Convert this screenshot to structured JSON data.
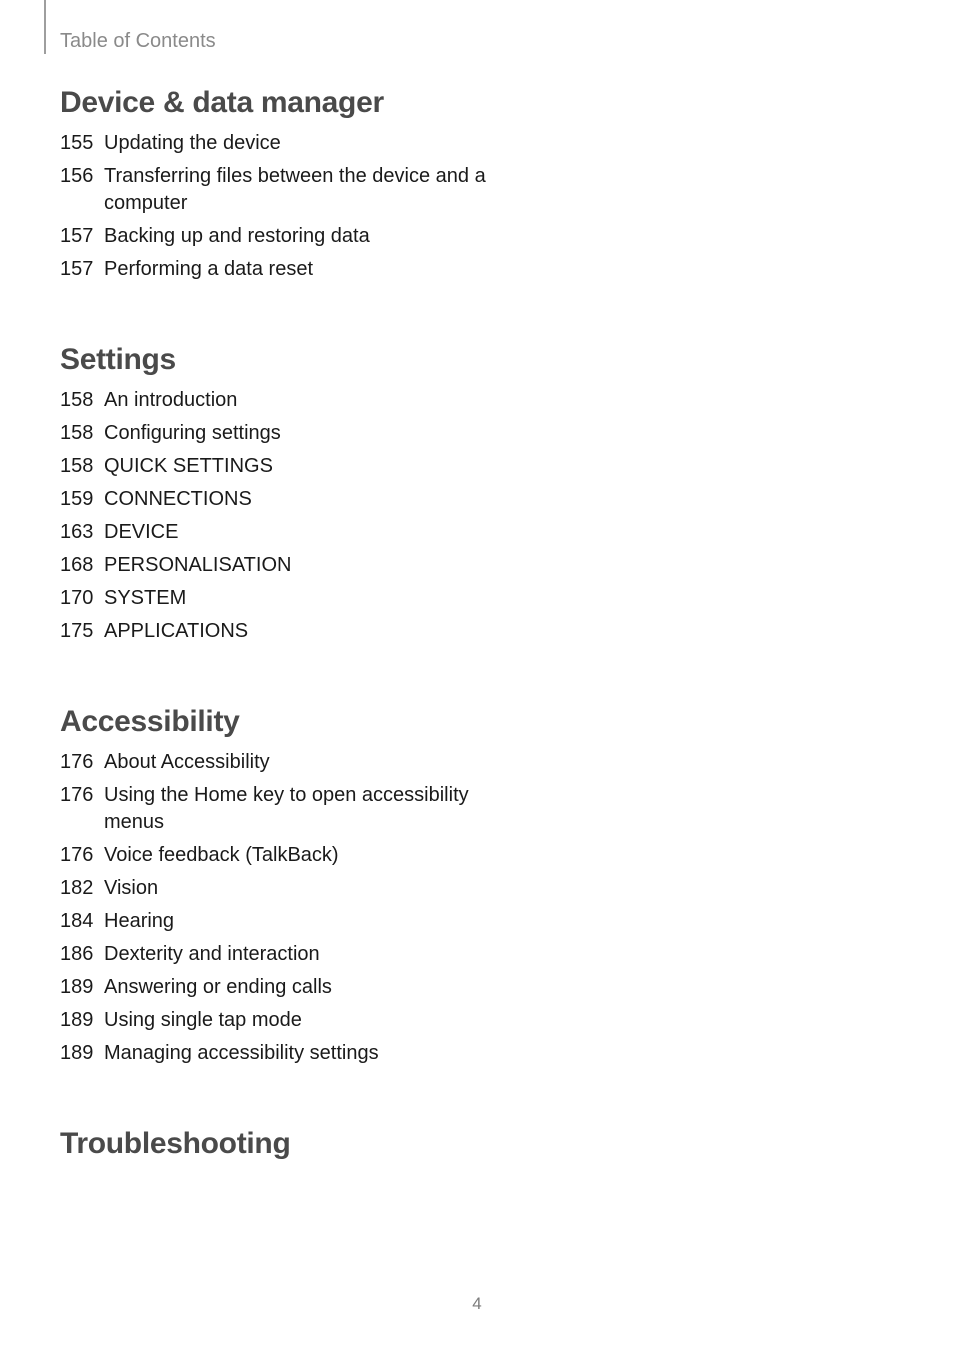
{
  "running_head": "Table of Contents",
  "page_number": "4",
  "sections": [
    {
      "title": "Device & data manager",
      "items": [
        {
          "page": "155",
          "text": "Updating the device"
        },
        {
          "page": "156",
          "text": "Transferring files between the device and a computer"
        },
        {
          "page": "157",
          "text": "Backing up and restoring data"
        },
        {
          "page": "157",
          "text": "Performing a data reset"
        }
      ]
    },
    {
      "title": "Settings",
      "items": [
        {
          "page": "158",
          "text": "An introduction"
        },
        {
          "page": "158",
          "text": "Configuring settings"
        },
        {
          "page": "158",
          "text": "QUICK SETTINGS"
        },
        {
          "page": "159",
          "text": "CONNECTIONS"
        },
        {
          "page": "163",
          "text": "DEVICE"
        },
        {
          "page": "168",
          "text": "PERSONALISATION"
        },
        {
          "page": "170",
          "text": "SYSTEM"
        },
        {
          "page": "175",
          "text": "APPLICATIONS"
        }
      ]
    },
    {
      "title": "Accessibility",
      "items": [
        {
          "page": "176",
          "text": "About Accessibility"
        },
        {
          "page": "176",
          "text": "Using the Home key to open accessibility menus"
        },
        {
          "page": "176",
          "text": "Voice feedback (TalkBack)"
        },
        {
          "page": "182",
          "text": "Vision"
        },
        {
          "page": "184",
          "text": "Hearing"
        },
        {
          "page": "186",
          "text": "Dexterity and interaction"
        },
        {
          "page": "189",
          "text": "Answering or ending calls"
        },
        {
          "page": "189",
          "text": "Using single tap mode"
        },
        {
          "page": "189",
          "text": "Managing accessibility settings"
        }
      ]
    },
    {
      "title": "Troubleshooting",
      "items": []
    }
  ]
}
